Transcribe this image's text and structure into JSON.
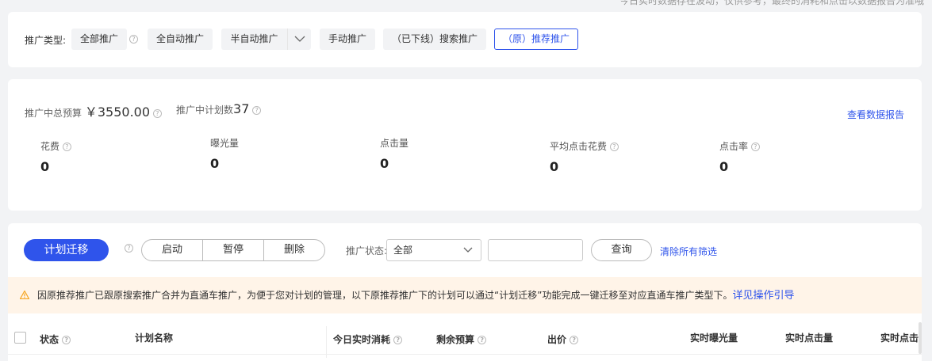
{
  "top_note": "今日实时数据存在波动，仅供参考，最终的消耗和点击以数据报告为准哦",
  "promo_types": {
    "label": "推广类型:",
    "items": [
      {
        "label": "全部推广",
        "has_help": true
      },
      {
        "label": "全自动推广"
      },
      {
        "label": "半自动推广",
        "has_dropdown": true
      },
      {
        "label": "手动推广"
      },
      {
        "label": "（已下线）搜索推广"
      },
      {
        "label": "（原）推荐推广",
        "active": true
      }
    ]
  },
  "summary": {
    "budget_label": "推广中总预算",
    "budget_value": "￥3550.00",
    "plans_label": "推广中计划数",
    "plans_value": "37",
    "report_link": "查看数据报告"
  },
  "metrics": [
    {
      "label": "花费",
      "value": "0",
      "has_help": true
    },
    {
      "label": "曝光量",
      "value": "0"
    },
    {
      "label": "点击量",
      "value": "0"
    },
    {
      "label": "平均点击花费",
      "value": "0",
      "has_help": true
    },
    {
      "label": "点击率",
      "value": "0",
      "has_help": true
    }
  ],
  "toolbar": {
    "migrate_label": "计划迁移",
    "start_label": "启动",
    "pause_label": "暂停",
    "delete_label": "删除",
    "status_label": "推广状态:",
    "status_value": "全部",
    "search_value": "",
    "query_label": "查询",
    "clear_label": "清除所有筛选"
  },
  "notice": {
    "text": "因原推荐推广已跟原搜索推广合并为直通车推广，为便于您对计划的管理，以下原推荐推广下的计划可以通过“计划迁移”功能完成一键迁移至对应直通车推广类型下。",
    "link": "详见操作引导",
    "accent_color": "#f5a623"
  },
  "table": {
    "columns": [
      {
        "label": "状态",
        "has_help": true
      },
      {
        "label": "计划名称"
      },
      {
        "label": "今日实时消耗",
        "has_help": true
      },
      {
        "label": "剩余预算",
        "has_help": true
      },
      {
        "label": "出价",
        "has_help": true
      },
      {
        "label": "实时曝光量"
      },
      {
        "label": "实时点击量"
      },
      {
        "label": "实时点击率"
      }
    ]
  },
  "colors": {
    "accent": "#2f54eb",
    "warning_bg": "#fff4e8",
    "page_bg": "#f2f3f5"
  }
}
